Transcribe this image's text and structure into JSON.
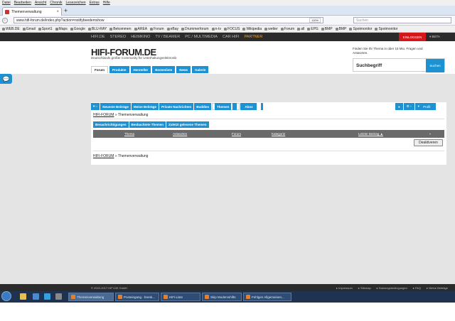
{
  "browser": {
    "menu": [
      "Datei",
      "Bearbeiten",
      "Ansicht",
      "Chronik",
      "Lesezeichen",
      "Extras",
      "Hilfe"
    ],
    "tab_title": "Themenverwaltung",
    "url": "www.hifi-forum.de/index.php?action=notifybeedemshow",
    "zoom": "110%",
    "search_placeholder": "Suchen",
    "bookmarks": [
      "WEB.DE",
      "Gmail",
      "Sport1",
      "Maps",
      "Google",
      "BLU-RAY",
      "Bekommen",
      "AREA",
      "Forum",
      "eBay",
      "Drummerforum",
      "n-tv",
      "FOCUS",
      "Wikipedia",
      "wetter",
      "Forum",
      "all",
      "EPG",
      "BMP",
      "BMP",
      "Spotmonitor",
      "Spotmonitor"
    ]
  },
  "site": {
    "topnav": [
      "HIFI.DE",
      "STEREO",
      "HEIMKINO",
      "TV / BEAMER",
      "PC / MULTIMEDIA",
      "CAR HIFI",
      "PARTNER"
    ],
    "login": "EINLOGGEN",
    "beta": "▾ BETA",
    "logo": "HIFI-FORUM.DE",
    "tagline": "Deutschlands größte Community für Unterhaltungselektronik",
    "search_info": "Finden Sie Ihr Thema in über 15 Mio. Fragen und Antworten.",
    "search_label": "Suchbegriff",
    "search_button": "Suchen",
    "subnav": [
      "Forum",
      "Produkte",
      "Hersteller",
      "Bestenliste",
      "News",
      "Galerie"
    ]
  },
  "content": {
    "tabs": [
      "Neueste Beiträge",
      "Meine Beiträge",
      "Private Nachrichten",
      "Buddies",
      "Themen",
      "Abos"
    ],
    "tab_badge_themen": "",
    "tab_badge_abos": "",
    "rtab_profil": "Profil",
    "crumb_home": "HIFI-FORUM",
    "crumb_sep": " » ",
    "crumb_current": "Themenverwaltung",
    "subtabs": [
      "Benachrichtigungen",
      "Beobachtete Themen",
      "Zuletzt gelesene Themen"
    ],
    "columns": [
      "Thema",
      "Antworten",
      "Forum",
      "Kategorie",
      "Letzter Beitrag ▲"
    ],
    "delete_button": "Deaktiveren"
  },
  "footer": {
    "copyright": "© 2002-2017 HIFI.DE GmbH",
    "links": [
      "▸ Impressum",
      "▸ Sitemap",
      "▸ Nutzungsbedingungen",
      "▸ FAQ",
      "▸ Meine Beiträge"
    ]
  },
  "taskbar": {
    "tasks": [
      "Themenverwaltung",
      "Posteingang - brenk...",
      "HiFi-Liste",
      "Skip Modemshifts",
      "Fehlgen Allgemeinen..."
    ]
  }
}
